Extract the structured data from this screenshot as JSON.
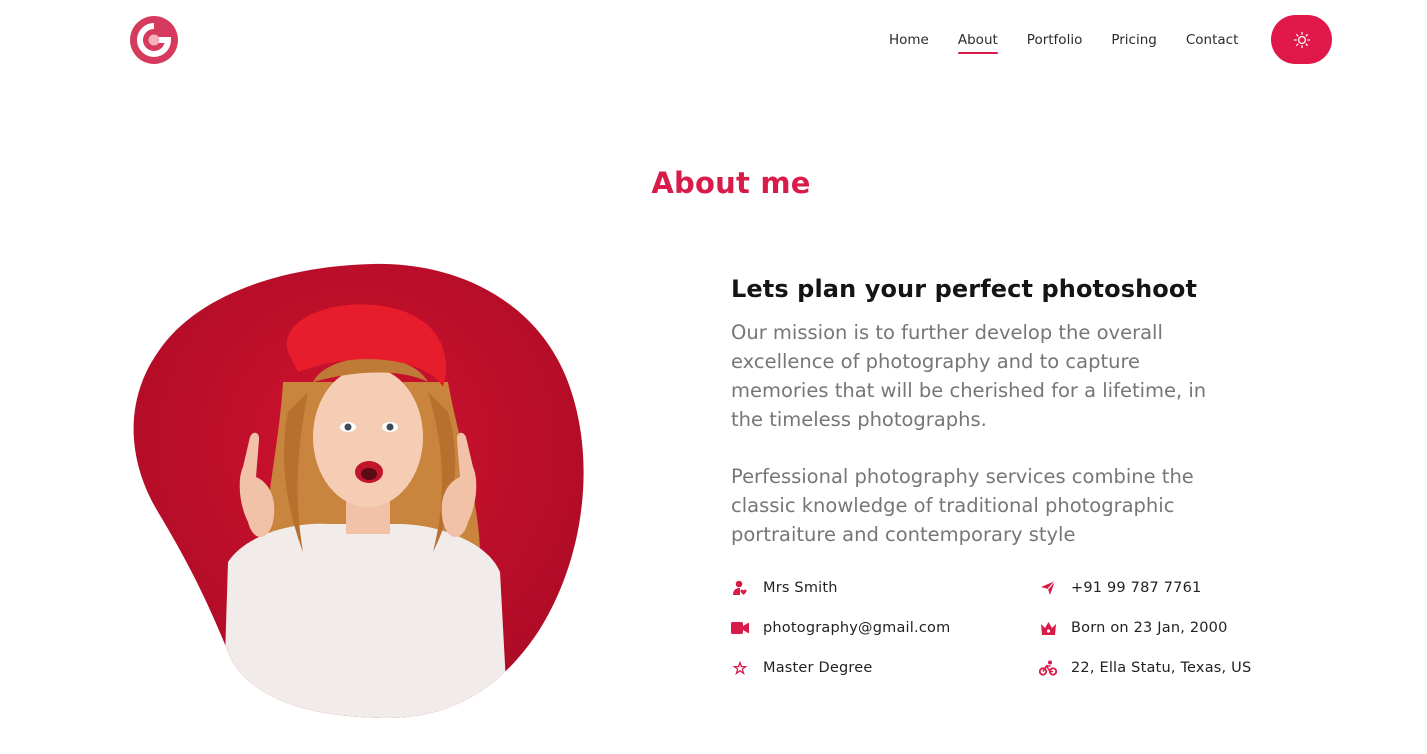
{
  "header": {
    "logo_icon": "camera-lens-logo",
    "nav": [
      {
        "label": "Home",
        "active": false
      },
      {
        "label": "About",
        "active": true
      },
      {
        "label": "Portfolio",
        "active": false
      },
      {
        "label": "Pricing",
        "active": false
      },
      {
        "label": "Contact",
        "active": false
      }
    ],
    "theme_toggle_icon": "sun-icon"
  },
  "about": {
    "title": "About me",
    "subtitle": "Lets plan your perfect photoshoot",
    "paragraph1": "Our mission is to further develop the overall excellence of photography and to capture memories that will be cherished for a lifetime, in the timeless photographs.",
    "paragraph2": "Perfessional photography services combine the classic knowledge of traditional photographic portraiture and contemporary style",
    "info": [
      {
        "icon": "user-heart-icon",
        "text": "Mrs Smith"
      },
      {
        "icon": "send-icon",
        "text": "+91 99 787 7761"
      },
      {
        "icon": "video-camera-icon",
        "text": "photography@gmail.com"
      },
      {
        "icon": "crown-icon",
        "text": "Born on 23 Jan, 2000"
      },
      {
        "icon": "star-icon",
        "text": "Master Degree"
      },
      {
        "icon": "bicycle-icon",
        "text": "22, Ella Statu, Texas, US"
      }
    ]
  },
  "colors": {
    "accent": "#d81b48",
    "button": "#e0184a",
    "photo_background": "#c8102e",
    "body_text": "#767676"
  }
}
